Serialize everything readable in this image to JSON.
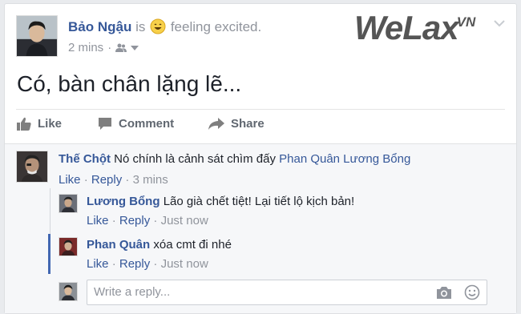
{
  "post": {
    "author": "Bảo Ngậu",
    "is_text": "is",
    "feeling": "feeling excited.",
    "time": "2 mins",
    "privacy_icon": "friends-icon",
    "text": "Có, bàn chân lặng lẽ..."
  },
  "brand": {
    "main": "WeLax",
    "suffix": ".VN",
    "color": "#555555"
  },
  "actions": {
    "like": "Like",
    "comment": "Comment",
    "share": "Share"
  },
  "comments": [
    {
      "name": "Thế Chột",
      "text": "Nó chính là cảnh sát chìm đấy",
      "tag": "Phan Quân Lương Bổng",
      "like": "Like",
      "reply": "Reply",
      "time": "3 mins"
    },
    {
      "name": "Lương Bổng",
      "text": "Lão già chết tiệt! Lại tiết lộ kịch bản!",
      "like": "Like",
      "reply": "Reply",
      "time": "Just now"
    },
    {
      "name": "Phan Quân",
      "text": "xóa cmt đi nhé",
      "like": "Like",
      "reply": "Reply",
      "time": "Just now"
    }
  ],
  "reply_box": {
    "placeholder": "Write a reply..."
  },
  "colors": {
    "link": "#365899",
    "meta": "#90949c",
    "accent": "#4267b2"
  }
}
